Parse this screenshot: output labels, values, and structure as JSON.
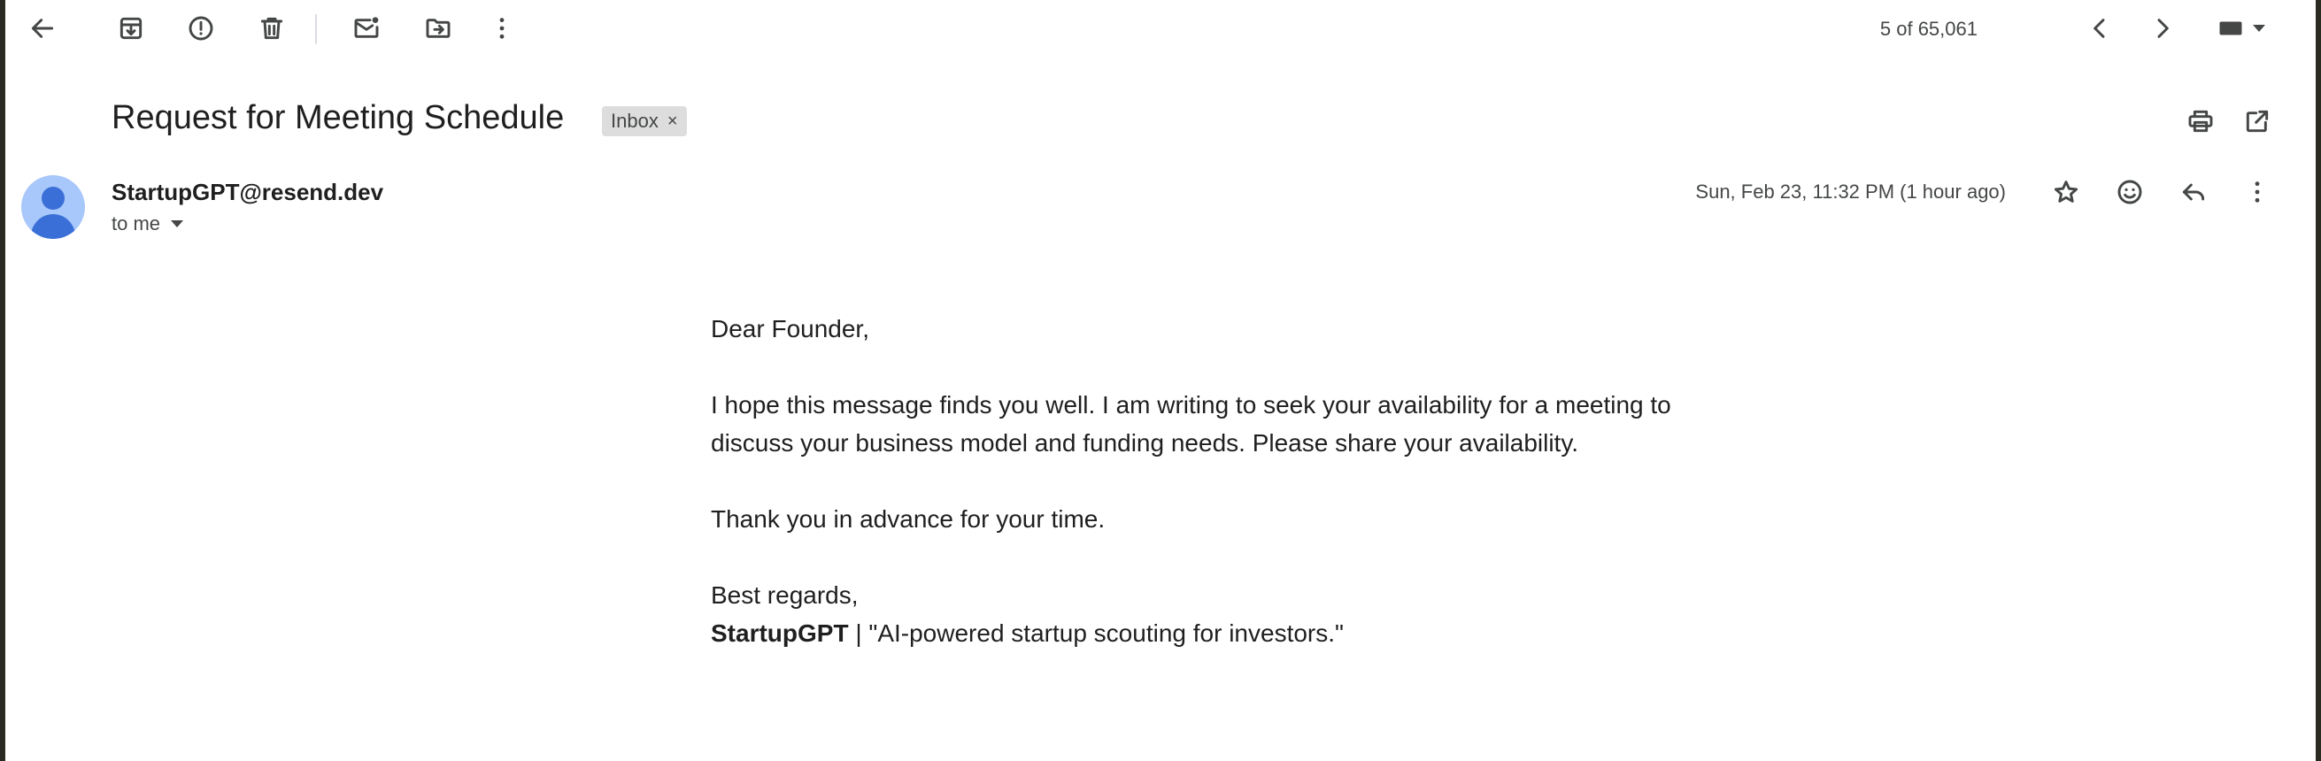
{
  "toolbar": {
    "back_icon": "arrow-left-icon",
    "archive_icon": "archive-icon",
    "spam_icon": "report-spam-icon",
    "delete_icon": "trash-icon",
    "mark_unread_icon": "mark-unread-icon",
    "move_icon": "move-to-icon",
    "more_icon": "more-vert-icon",
    "pagination": "5 of 65,061",
    "prev_icon": "chevron-left-icon",
    "next_icon": "chevron-right-icon",
    "keyboard_icon": "keyboard-icon"
  },
  "email": {
    "subject": "Request for Meeting Schedule",
    "label": "Inbox",
    "label_remove": "×",
    "sender": "StartupGPT@resend.dev",
    "recipient": "to me",
    "date": "Sun, Feb 23, 11:32 PM (1 hour ago)",
    "body": {
      "greeting": "Dear Founder,",
      "paragraph": "I hope this message finds you well. I am writing to seek your availability for a meeting to discuss your business model and funding needs. Please share your availability.",
      "thanks": "Thank you in advance for your time.",
      "closing": "Best regards,",
      "signature_name": "StartupGPT",
      "signature_tagline": " | \"AI-powered startup scouting for investors.\""
    }
  },
  "colors": {
    "avatar_bg": "#a8c7fa",
    "avatar_fg": "#3b6fd8",
    "chip_bg": "#dddddd",
    "icon": "#444746"
  }
}
